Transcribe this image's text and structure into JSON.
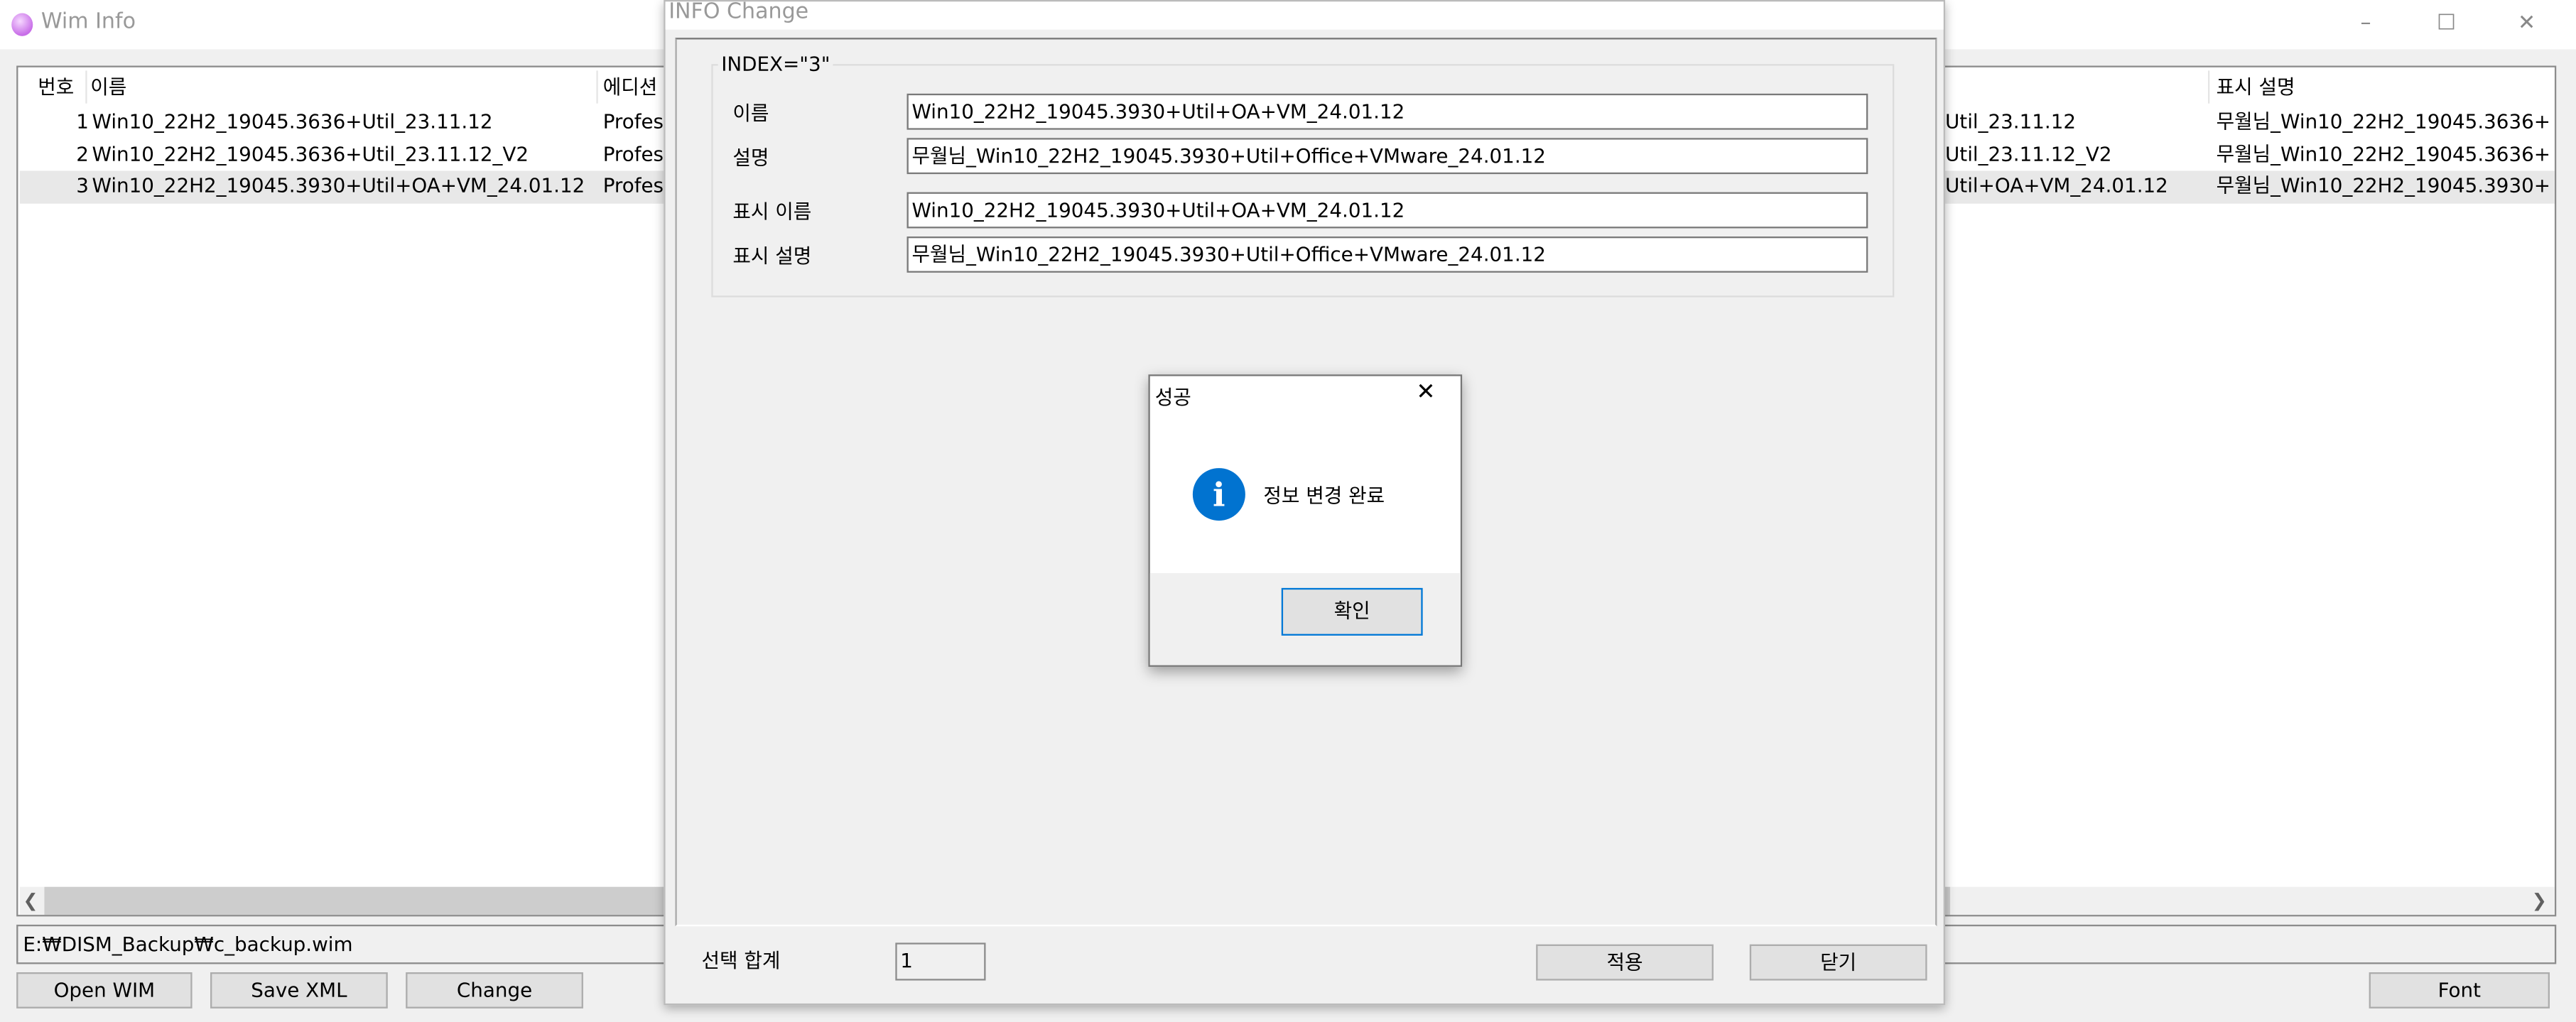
{
  "window": {
    "title": "Wim Info",
    "icon": "disc-icon",
    "controls": {
      "minimize": "–",
      "maximize": "☐",
      "close": "✕"
    }
  },
  "list": {
    "columns": [
      "번호",
      "이름",
      "에디션",
      "표시 설명"
    ],
    "rows": [
      {
        "index": "1",
        "name": "Win10_22H2_19045.3636+Util_23.11.12",
        "edition": "Profess",
        "display_name": "Util_23.11.12",
        "display_desc": "무월님_Win10_22H2_19045.3636+"
      },
      {
        "index": "2",
        "name": "Win10_22H2_19045.3636+Util_23.11.12_V2",
        "edition": "Profess",
        "display_name": "Util_23.11.12_V2",
        "display_desc": "무월님_Win10_22H2_19045.3636+"
      },
      {
        "index": "3",
        "name": "Win10_22H2_19045.3930+Util+OA+VM_24.01.12",
        "edition": "Profess",
        "display_name": "Util+OA+VM_24.01.12",
        "display_desc": "무월님_Win10_22H2_19045.3930+"
      }
    ],
    "selected_row": 3
  },
  "path": "E:₩DISM_Backup₩c_backup.wim",
  "buttons": {
    "open": "Open WIM",
    "save": "Save XML",
    "change": "Change",
    "font": "Font"
  },
  "dialog": {
    "title": "INFO Change",
    "group_label": "INDEX=\"3\"",
    "fields": [
      {
        "label": "이름",
        "value": "Win10_22H2_19045.3930+Util+OA+VM_24.01.12"
      },
      {
        "label": "설명",
        "value": "무월님_Win10_22H2_19045.3930+Util+Office+VMware_24.01.12"
      },
      {
        "label": "표시 이름",
        "value": "Win10_22H2_19045.3930+Util+OA+VM_24.01.12"
      },
      {
        "label": "표시 설명",
        "value": "무월님_Win10_22H2_19045.3930+Util+Office+VMware_24.01.12"
      }
    ],
    "total_label": "선택 합계",
    "total_value": "1",
    "apply": "적용",
    "close": "닫기"
  },
  "msgbox": {
    "title": "성공",
    "close": "✕",
    "icon": "info-icon",
    "message": "정보 변경 완료",
    "ok": "확인",
    "accent": "#0173d0"
  }
}
